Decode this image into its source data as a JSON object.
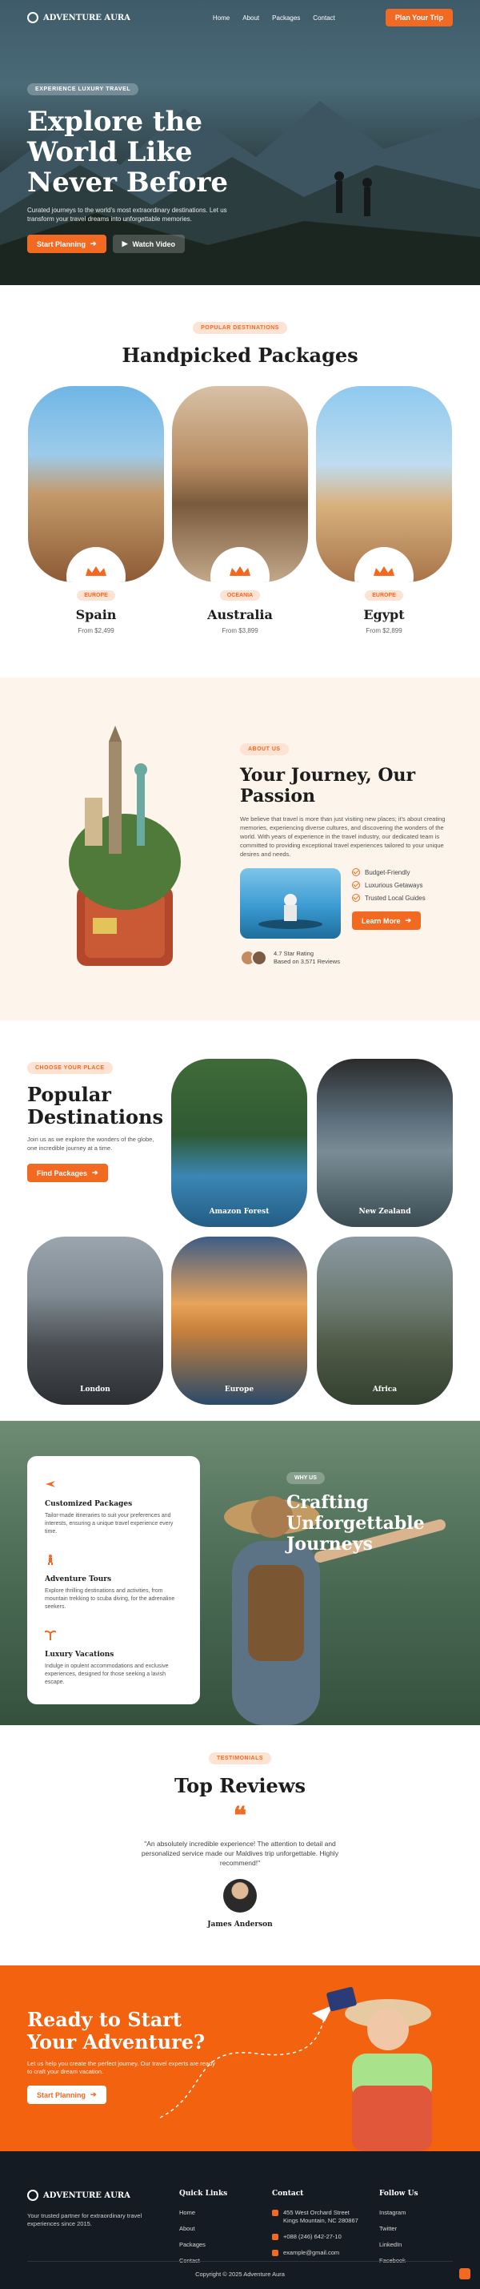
{
  "nav": {
    "brand": "ADVENTURE AURA",
    "links": [
      "Home",
      "About",
      "Packages",
      "Contact"
    ],
    "cta": "Plan Your Trip"
  },
  "hero": {
    "chip": "EXPERIENCE LUXURY TRAVEL",
    "title": "Explore the World Like Never Before",
    "subtitle": "Curated journeys to the world's most extraordinary destinations. Let us transform your travel dreams into unforgettable memories.",
    "btn_primary": "Start Planning",
    "btn_secondary": "Watch Video"
  },
  "packages": {
    "chip": "POPULAR DESTINATIONS",
    "title": "Handpicked Packages",
    "items": [
      {
        "region": "EUROPE",
        "name": "Spain",
        "price": "From $2,499"
      },
      {
        "region": "OCEANIA",
        "name": "Australia",
        "price": "From $3,899"
      },
      {
        "region": "EUROPE",
        "name": "Egypt",
        "price": "From $2,899"
      }
    ]
  },
  "about": {
    "chip": "ABOUT US",
    "title": "Your Journey, Our Passion",
    "text": "We believe that travel is more than just visiting new places; it's about creating memories, experiencing diverse cultures, and discovering the wonders of the world. With years of experience in the travel industry, our dedicated team is committed to providing exceptional travel experiences tailored to your unique desires and needs.",
    "features": [
      "Budget-Friendly",
      "Luxurious Getaways",
      "Trusted Local Guides"
    ],
    "btn": "Learn More",
    "rating_title": "4.7 Star Rating",
    "rating_sub": "Based on 3,571 Reviews"
  },
  "destinations": {
    "chip": "CHOOSE YOUR PLACE",
    "title": "Popular Destinations",
    "text": "Join us as we explore the wonders of the globe, one incredible journey at a time.",
    "btn": "Find Packages",
    "tiles": [
      "Amazon Forest",
      "New Zealand",
      "London",
      "Europe",
      "Africa"
    ]
  },
  "crafting": {
    "chip": "WHY US",
    "title": "Crafting Unforgettable Journeys",
    "items": [
      {
        "title": "Customized Packages",
        "text": "Tailor-made itineraries to suit your preferences and interests, ensuring a unique travel experience every time."
      },
      {
        "title": "Adventure Tours",
        "text": "Explore thrilling destinations and activities, from mountain trekking to scuba diving, for the adrenaline seekers."
      },
      {
        "title": "Luxury Vacations",
        "text": "Indulge in opulent accommodations and exclusive experiences, designed for those seeking a lavish escape."
      }
    ]
  },
  "reviews": {
    "chip": "TESTIMONIALS",
    "title": "Top Reviews",
    "quote": "\"An absolutely incredible experience! The attention to detail and personalized service made our Maldives trip unforgettable. Highly recommend!\"",
    "name": "James Anderson"
  },
  "cta": {
    "title": "Ready to Start Your Adventure?",
    "text": "Let us help you create the perfect journey. Our travel experts are ready to craft your dream vacation.",
    "btn": "Start Planning"
  },
  "footer": {
    "brand": "ADVENTURE AURA",
    "tagline": "Your trusted partner for extraordinary travel experiences since 2015.",
    "quick_links_title": "Quick Links",
    "quick_links": [
      "Home",
      "About",
      "Packages",
      "Contact"
    ],
    "contact_title": "Contact",
    "contact": [
      "455 West Orchard Street Kings Mountain, NC 280867",
      "+088 (246) 642-27-10",
      "example@gmail.com"
    ],
    "follow_title": "Follow Us",
    "follow": [
      "Instagram",
      "Twitter",
      "LinkedIn",
      "Facebook"
    ],
    "copyright": "Copyright © 2025 Adventure Aura"
  },
  "colors": {
    "accent": "#f26a21",
    "dark": "#141b23",
    "cream": "#fdf4ec"
  }
}
